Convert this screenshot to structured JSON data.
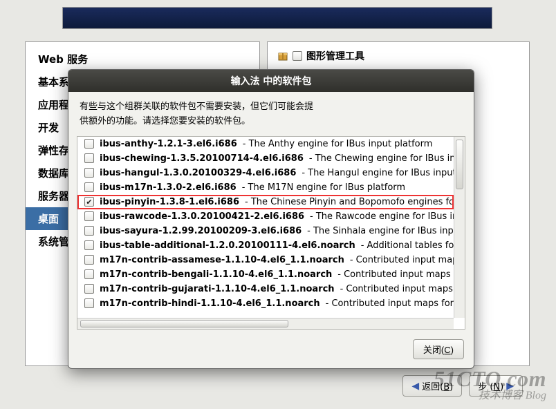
{
  "banner": {},
  "categories": [
    "Web 服务",
    "基本系",
    "应用程",
    "开发",
    "弹性存",
    "数据库",
    "服务器",
    "桌面",
    "系统管"
  ],
  "selected_category_index": 7,
  "right_panel": {
    "checkbox_checked": false,
    "label": "图形管理工具"
  },
  "dialog": {
    "title": "输入法 中的软件包",
    "desc_line1": "有些与这个组群关联的软件包不需要安装，但它们可能会提",
    "desc_line2": "供额外的功能。请选择您要安装的软件包。",
    "close_label": "关闭(",
    "close_key": "C",
    "close_tail": ")"
  },
  "packages": [
    {
      "checked": false,
      "name": "ibus-anthy-1.2.1-3.el6.i686",
      "desc": " - The Anthy engine for IBus input platform",
      "hl": false
    },
    {
      "checked": false,
      "name": "ibus-chewing-1.3.5.20100714-4.el6.i686",
      "desc": " - The Chewing engine for IBus inpu",
      "hl": false
    },
    {
      "checked": false,
      "name": "ibus-hangul-1.3.0.20100329-4.el6.i686",
      "desc": " - The Hangul engine for IBus input p",
      "hl": false
    },
    {
      "checked": false,
      "name": "ibus-m17n-1.3.0-2.el6.i686",
      "desc": " - The M17N engine for IBus platform",
      "hl": false
    },
    {
      "checked": true,
      "name": "ibus-pinyin-1.3.8-1.el6.i686",
      "desc": " - The Chinese Pinyin and Bopomofo engines for I",
      "hl": true
    },
    {
      "checked": false,
      "name": "ibus-rawcode-1.3.0.20100421-2.el6.i686",
      "desc": " - The Rawcode engine for IBus inp",
      "hl": false
    },
    {
      "checked": false,
      "name": "ibus-sayura-1.2.99.20100209-3.el6.i686",
      "desc": " - The Sinhala engine for IBus input",
      "hl": false
    },
    {
      "checked": false,
      "name": "ibus-table-additional-1.2.0.20100111-4.el6.noarch",
      "desc": " - Additional tables for",
      "hl": false
    },
    {
      "checked": false,
      "name": "m17n-contrib-assamese-1.1.10-4.el6_1.1.noarch",
      "desc": " - Contributed input maps",
      "hl": false
    },
    {
      "checked": false,
      "name": "m17n-contrib-bengali-1.1.10-4.el6_1.1.noarch",
      "desc": " - Contributed input maps fo",
      "hl": false
    },
    {
      "checked": false,
      "name": "m17n-contrib-gujarati-1.1.10-4.el6_1.1.noarch",
      "desc": " - Contributed input maps fo",
      "hl": false
    },
    {
      "checked": false,
      "name": "m17n-contrib-hindi-1.1.10-4.el6_1.1.noarch",
      "desc": " - Contributed input maps for H",
      "hl": false
    }
  ],
  "nav": {
    "back_label": "返回(",
    "back_key": "B",
    "back_tail": ")",
    "next_prefix": "步 (",
    "next_key": "N",
    "next_tail": ")"
  },
  "watermark": {
    "big": "51CTO.com",
    "sub": "技术博客  Blog"
  }
}
